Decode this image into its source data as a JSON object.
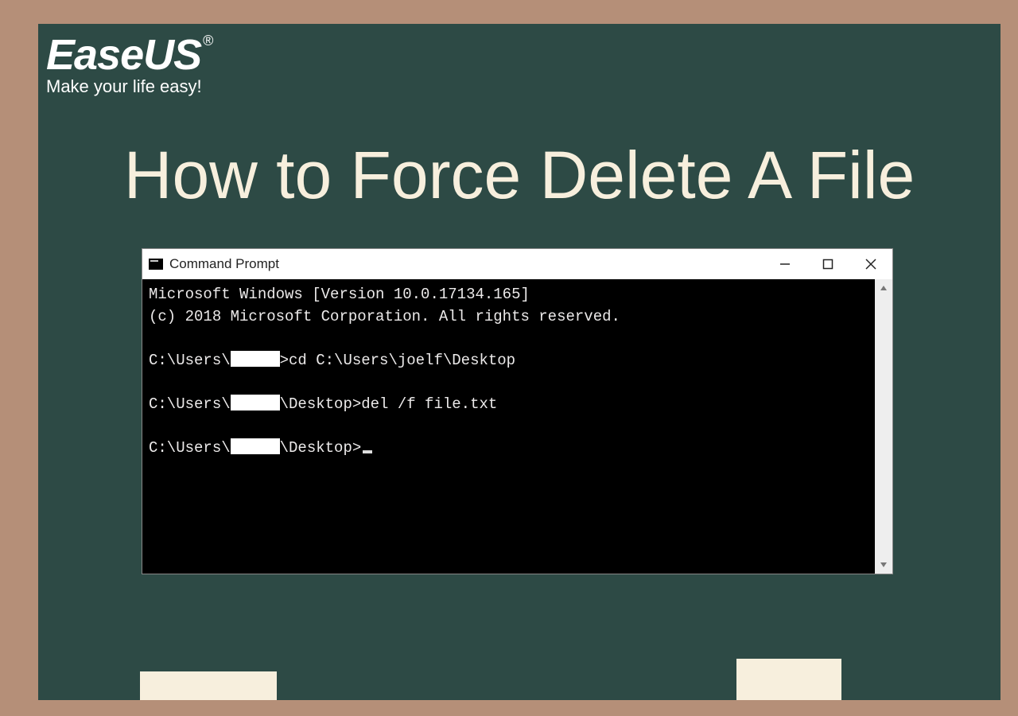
{
  "brand": {
    "name": "EaseUS",
    "registered": "®",
    "tagline": "Make your life easy!"
  },
  "title": "How to Force Delete A File",
  "window": {
    "title": "Command Prompt"
  },
  "terminal": {
    "line1": "Microsoft Windows [Version 10.0.17134.165]",
    "line2": "(c) 2018 Microsoft Corporation. All rights reserved.",
    "p1a": "C:\\Users\\",
    "p1b": ">cd C:\\Users\\joelf\\Desktop",
    "p2a": "C:\\Users\\",
    "p2b": "\\Desktop>del /f file.txt",
    "p3a": "C:\\Users\\",
    "p3b": "\\Desktop>"
  }
}
